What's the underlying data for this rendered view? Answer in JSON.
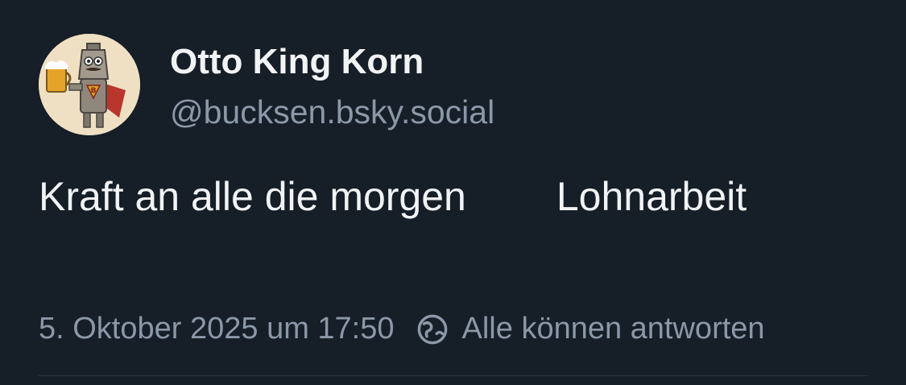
{
  "author": {
    "display_name": "Otto King Korn",
    "handle": "@bucksen.bsky.social",
    "avatar_icon": "beer-robot-avatar-icon"
  },
  "post": {
    "text_part1": "Kraft an alle die morgen",
    "text_part2": "Lohnarbeit"
  },
  "meta": {
    "timestamp": "5. Oktober 2025 um 17:50",
    "reply_setting": "Alle können antworten",
    "reply_icon": "globe-icon"
  },
  "colors": {
    "background": "#161e27",
    "text_primary": "#f1f3f5",
    "text_secondary": "#8b98a8"
  }
}
